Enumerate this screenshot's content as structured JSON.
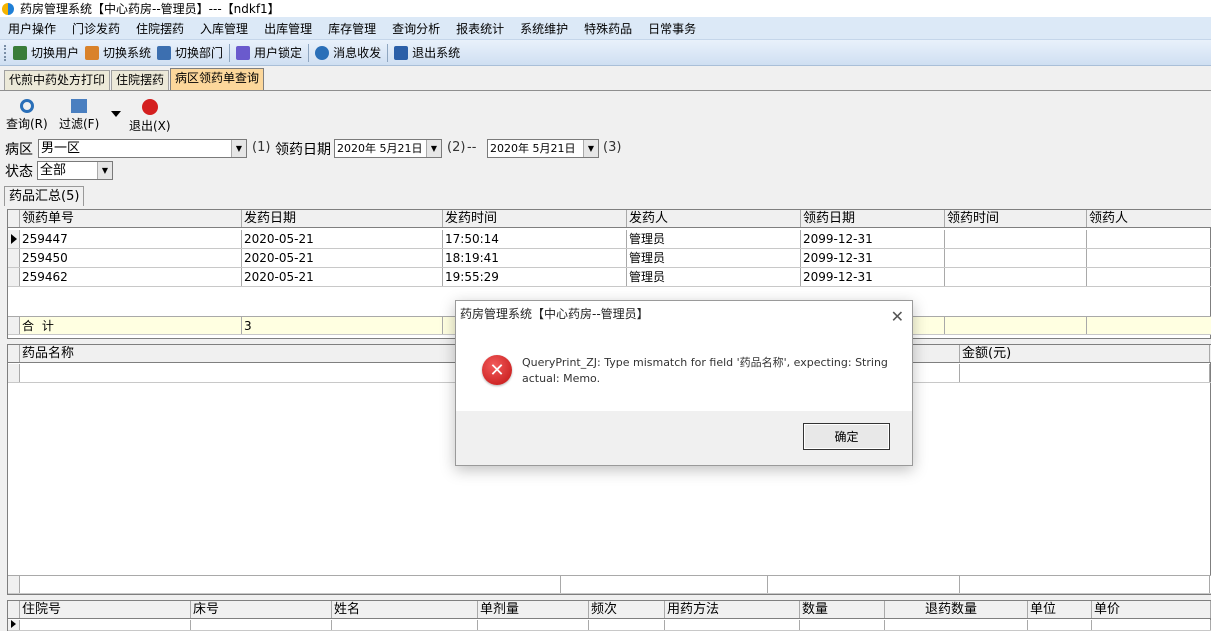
{
  "window": {
    "title": "药房管理系统【中心药房--管理员】---【ndkf1】"
  },
  "menu": [
    "用户操作",
    "门诊发药",
    "住院摆药",
    "入库管理",
    "出库管理",
    "库存管理",
    "查询分析",
    "报表统计",
    "系统维护",
    "特殊药品",
    "日常事务"
  ],
  "toolbar": [
    {
      "label": "切换用户",
      "icon": "switch-user-icon",
      "color": "#3a7d3a"
    },
    {
      "label": "切换系统",
      "icon": "switch-system-icon",
      "color": "#d9822b"
    },
    {
      "label": "切换部门",
      "icon": "switch-department-icon",
      "color": "#3c6fb0"
    },
    {
      "label": "用户锁定",
      "icon": "user-lock-icon",
      "color": "#6a5acd"
    },
    {
      "label": "消息收发",
      "icon": "message-icon",
      "color": "#2a6fb8"
    },
    {
      "label": "退出系统",
      "icon": "exit-system-icon",
      "color": "#2b5fa8"
    }
  ],
  "tabs": [
    "代煎中药处方打印",
    "住院摆药",
    "病区领药单查询"
  ],
  "actions": {
    "query": "查询(R)",
    "filter": "过滤(F)",
    "exit": "退出(X)"
  },
  "form": {
    "ward_label": "病区",
    "ward_value": "男一区",
    "hint1": "(1)",
    "date_label": "领药日期",
    "date_from": "2020年 5月21日",
    "hint2": "(2)",
    "dash": "--",
    "date_to": "2020年 5月21日",
    "hint3": "(3)",
    "status_label": "状态",
    "status_value": "全部"
  },
  "subtab": "药品汇总(5)",
  "grid1": {
    "columns": [
      "领药单号",
      "发药日期",
      "发药时间",
      "发药人",
      "领药日期",
      "领药时间",
      "领药人"
    ],
    "rows": [
      [
        "259447",
        "2020-05-21",
        "17:50:14",
        "管理员",
        "2099-12-31",
        "",
        ""
      ],
      [
        "259450",
        "2020-05-21",
        "18:19:41",
        "管理员",
        "2099-12-31",
        "",
        ""
      ],
      [
        "259462",
        "2020-05-21",
        "19:55:29",
        "管理员",
        "2099-12-31",
        "",
        ""
      ]
    ],
    "total_label": "合  计",
    "total_value": "3"
  },
  "grid2": {
    "columns": [
      "药品名称",
      "金额(元)"
    ]
  },
  "grid3": {
    "columns": [
      "住院号",
      "床号",
      "姓名",
      "单剂量",
      "频次",
      "用药方法",
      "数量",
      "退药数量",
      "单位",
      "单价"
    ]
  },
  "dialog": {
    "title": "药房管理系统【中心药房--管理员】",
    "message": "QueryPrint_ZJ: Type mismatch for field '药品名称', expecting: String actual: Memo.",
    "ok": "确定",
    "close": "✕"
  }
}
